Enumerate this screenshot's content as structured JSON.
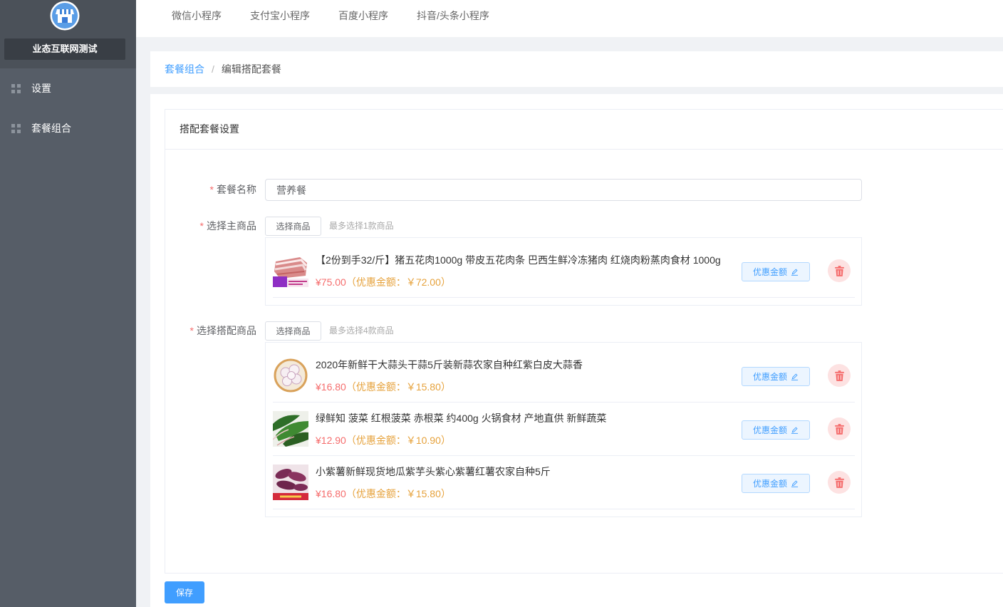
{
  "sidebar": {
    "logo_icon": "store-icon",
    "brand_name": "业态互联网测试",
    "items": [
      {
        "label": "设置",
        "icon": "grid-icon"
      },
      {
        "label": "套餐组合",
        "icon": "grid-icon"
      }
    ]
  },
  "topnav": {
    "tabs": [
      {
        "label": "微信小程序"
      },
      {
        "label": "支付宝小程序"
      },
      {
        "label": "百度小程序"
      },
      {
        "label": "抖音/头条小程序"
      }
    ]
  },
  "breadcrumb": {
    "parent": "套餐组合",
    "separator": "/",
    "current": "编辑搭配套餐"
  },
  "card": {
    "title": "搭配套餐设置"
  },
  "form": {
    "required_mark": "*",
    "name": {
      "label": "套餐名称",
      "value": "营养餐"
    },
    "main_product": {
      "label": "选择主商品",
      "button_label": "选择商品",
      "hint": "最多选择1款商品",
      "items": [
        {
          "title": "【2份到手32/斤】猪五花肉1000g 带皮五花肉条 巴西生鲜冷冻猪肉 红烧肉粉蒸肉食材 1000g",
          "price": "¥75.00",
          "discount": "（优惠金额：￥72.00）",
          "image": "pork-image"
        }
      ]
    },
    "combo_products": {
      "label": "选择搭配商品",
      "button_label": "选择商品",
      "hint": "最多选择4款商品",
      "items": [
        {
          "title": "2020年新鲜干大蒜头干蒜5斤装新蒜农家自种红紫白皮大蒜香",
          "price": "¥16.80",
          "discount": "（优惠金额：￥15.80）",
          "image": "garlic-image"
        },
        {
          "title": "绿鲜知 菠菜 红根菠菜 赤根菜 约400g 火锅食材 产地直供 新鲜蔬菜",
          "price": "¥12.90",
          "discount": "（优惠金额：￥10.90）",
          "image": "spinach-image"
        },
        {
          "title": "小紫薯新鲜现货地瓜紫芋头紫心紫薯红薯农家自种5斤",
          "price": "¥16.80",
          "discount": "（优惠金额：￥15.80）",
          "image": "sweet-potato-image"
        }
      ]
    },
    "discount_button_label": "优惠金额",
    "save_label": "保存"
  },
  "colors": {
    "primary": "#409eff",
    "price": "#f56c6c",
    "discount": "#e6a23c",
    "required": "#f56c6c",
    "sidebar": "#565d67",
    "delete_bg": "#fde2e2"
  },
  "icons": {
    "edit": "pencil-icon",
    "delete": "trash-icon",
    "menu": "grid-icon"
  }
}
